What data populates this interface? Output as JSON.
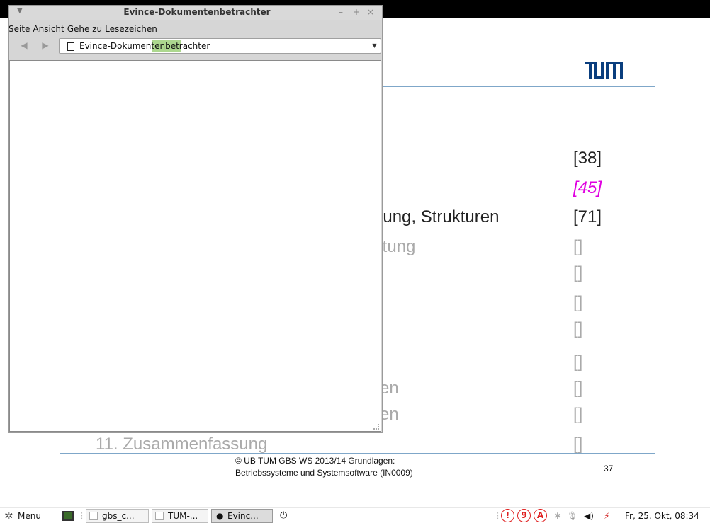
{
  "slide": {
    "logo": "TUM",
    "entries": [
      {
        "text": "",
        "num": "[38]"
      },
      {
        "text": "",
        "num": "[45]"
      },
      {
        "text": "erung, Strukturen",
        "num": "[71]"
      },
      {
        "text": "altung",
        "num": "[]"
      },
      {
        "text": "",
        "num": "[]"
      },
      {
        "text": "",
        "num": "[]"
      },
      {
        "text": "",
        "num": "[]"
      },
      {
        "text": "",
        "num": "[]"
      },
      {
        "text": "en",
        "num": "[]"
      },
      {
        "text": "en",
        "num": "[]"
      },
      {
        "text": "11. Zusammenfassung",
        "num": "[]"
      }
    ],
    "footer_line1": "© UB TUM GBS WS 2013/14 Grundlagen:",
    "footer_line2": "Betriebssysteme und Systemsoftware (IN0009)",
    "page_number": "37"
  },
  "window": {
    "title": "Evince-Dokumentenbetrachter",
    "menu": [
      "Seite",
      "Ansicht",
      "Gehe zu",
      "Lesezeichen"
    ],
    "address": "Evince-Dokumentenbetrachter",
    "controls": {
      "minimize": "–",
      "maximize": "+",
      "close": "×"
    }
  },
  "taskbar": {
    "menu_label": "Menu",
    "windows": [
      {
        "label": "gbs_c..."
      },
      {
        "label": "TUM-..."
      },
      {
        "label": "Evinc..."
      }
    ],
    "tray_badges": [
      "!",
      "9",
      "A"
    ],
    "clock": "Fr, 25. Okt, 08:34"
  },
  "colors": {
    "accent_blue": "#7fa7c9",
    "highlight_magenta": "#e000e0",
    "tray_red": "#e02020",
    "progress_green": "#9dd07a"
  }
}
